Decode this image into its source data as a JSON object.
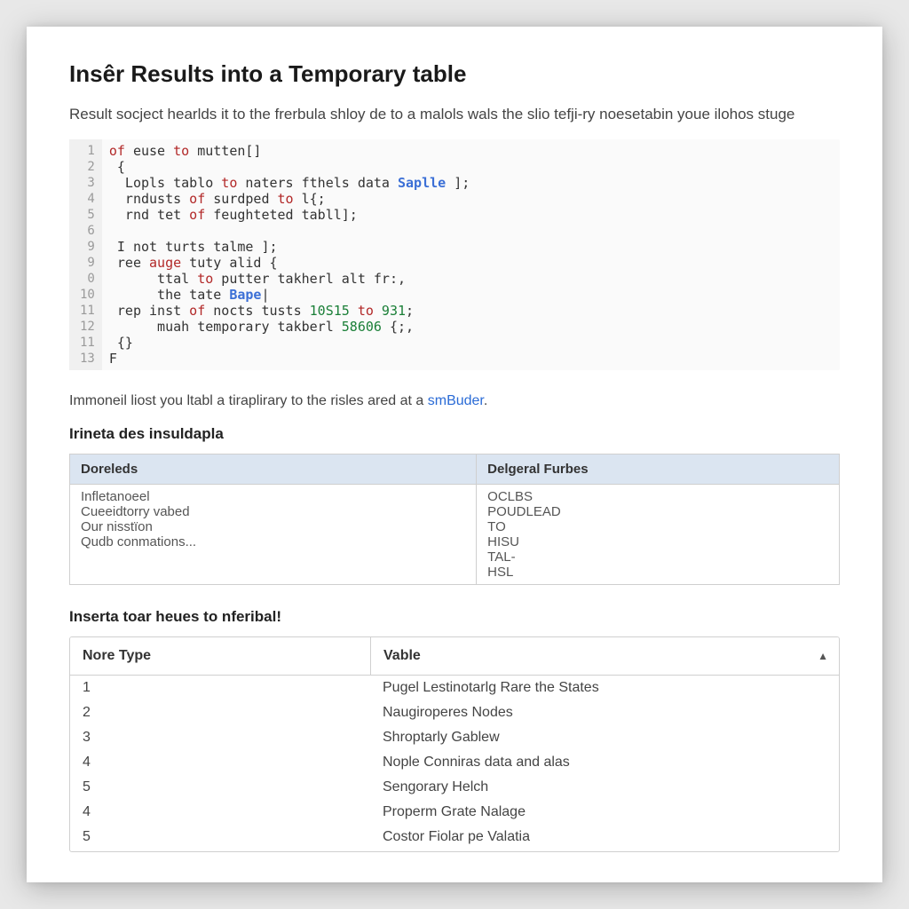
{
  "title": "Insêr Results into a Temporary table",
  "intro": "Result socject hearlds it to the frerbula shloy de to a malols wals the slio tefji-ry noesetabin youe ilohos stuge",
  "code": {
    "gutter": [
      "1",
      "2",
      "3",
      "4",
      "5",
      "6",
      "9",
      "9",
      "0",
      "10",
      "11",
      "12",
      "11",
      "13"
    ],
    "lines": [
      [
        {
          "t": "of",
          "c": "kw"
        },
        {
          "t": " euse ",
          "c": "id"
        },
        {
          "t": "to",
          "c": "kw"
        },
        {
          "t": " mutten[]",
          "c": "id"
        }
      ],
      [
        {
          "t": " {",
          "c": "id"
        }
      ],
      [
        {
          "t": "  Lopls tablo ",
          "c": "id"
        },
        {
          "t": "to",
          "c": "kw"
        },
        {
          "t": " naters fthels data ",
          "c": "id"
        },
        {
          "t": "Saplle",
          "c": "blue"
        },
        {
          "t": " ];",
          "c": "id"
        }
      ],
      [
        {
          "t": "  rndusts ",
          "c": "id"
        },
        {
          "t": "of",
          "c": "kw"
        },
        {
          "t": " surdped ",
          "c": "id"
        },
        {
          "t": "to",
          "c": "kw"
        },
        {
          "t": " l{;",
          "c": "id"
        }
      ],
      [
        {
          "t": "  rnd tet ",
          "c": "id"
        },
        {
          "t": "of",
          "c": "kw"
        },
        {
          "t": " feughteted tabll];",
          "c": "id"
        }
      ],
      [
        {
          "t": "",
          "c": "id"
        }
      ],
      [
        {
          "t": " I not turts talme ];",
          "c": "id"
        }
      ],
      [
        {
          "t": " ree ",
          "c": "id"
        },
        {
          "t": "auge",
          "c": "kw"
        },
        {
          "t": " tuty alid {",
          "c": "id"
        }
      ],
      [
        {
          "t": "      ttal ",
          "c": "id"
        },
        {
          "t": "to",
          "c": "kw"
        },
        {
          "t": " putter takherl alt fr:,",
          "c": "id"
        }
      ],
      [
        {
          "t": "      the tate ",
          "c": "id"
        },
        {
          "t": "Bape",
          "c": "blue"
        },
        {
          "t": "|",
          "c": "id"
        }
      ],
      [
        {
          "t": " rep inst ",
          "c": "id"
        },
        {
          "t": "of",
          "c": "kw"
        },
        {
          "t": " nocts tusts ",
          "c": "id"
        },
        {
          "t": "10S15",
          "c": "num"
        },
        {
          "t": " to ",
          "c": "kw"
        },
        {
          "t": "931",
          "c": "num"
        },
        {
          "t": ";",
          "c": "id"
        }
      ],
      [
        {
          "t": "      muah temporary takberl ",
          "c": "id"
        },
        {
          "t": "58606",
          "c": "num"
        },
        {
          "t": " {;,",
          "c": "id"
        }
      ],
      [
        {
          "t": " {}",
          "c": "id"
        }
      ],
      [
        {
          "t": "F",
          "c": "id"
        }
      ]
    ]
  },
  "paragraph_before_link": "Immoneil liost you ltabl a tiraplirary to the risles ared at a ",
  "paragraph_link": "smBuder",
  "paragraph_after_link": ".",
  "section1_heading": "Irineta des insuldapla",
  "table1": {
    "headers": [
      "Doreleds",
      "Delgeral Furbes"
    ],
    "col1": [
      "Infletanoeel",
      "Cueeidtorry vabed",
      "Our nisstïon",
      "Qudb conmations..."
    ],
    "col2": [
      "OCLBS",
      "POUDLEAD",
      "TO",
      "HISU",
      "TAL-",
      "HSL"
    ]
  },
  "section2_heading": "Inserta toar heues to nferibal!",
  "table2": {
    "headers": [
      "Nore Type",
      "Vable"
    ],
    "rows": [
      {
        "a": "1",
        "b": "Pugel Lestinotarlg Rare the States"
      },
      {
        "a": "2",
        "b": "Naugiroperes Nodes"
      },
      {
        "a": "3",
        "b": "Shroptarly Gablew"
      },
      {
        "a": "4",
        "b": "Nople Conniras data and alas"
      },
      {
        "a": "5",
        "b": "Sengorary Helch"
      },
      {
        "a": "4",
        "b": "Properm Grate Nalage"
      },
      {
        "a": "5",
        "b": "Costor Fiolar pe Valatia"
      }
    ]
  }
}
